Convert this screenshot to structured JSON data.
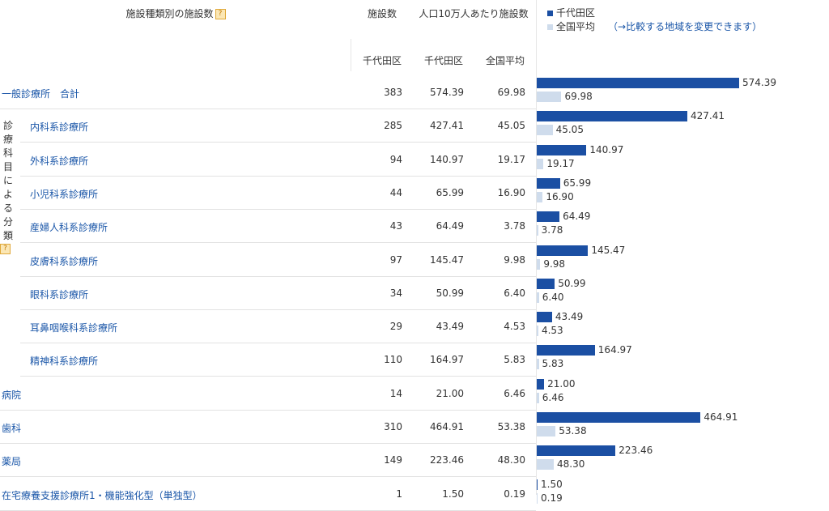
{
  "header": {
    "title": "施設種類別の施設数",
    "help": "?",
    "count": "施設数",
    "per_capita": "人口10万人あたり施設数",
    "sub_count": "千代田区",
    "sub_per": "千代田区",
    "sub_nat": "全国平均"
  },
  "legend": {
    "region": "千代田区",
    "national": "全国平均",
    "change_link": "（→比較する地域を変更できます）"
  },
  "colors": {
    "region": "#1b4fa3",
    "national": "#cfdcec",
    "link": "#1a56a8"
  },
  "group_label": [
    "診",
    "療",
    "科",
    "目",
    "に",
    "よ",
    "る",
    "分",
    "類"
  ],
  "rows": [
    {
      "label": "一般診療所　合計",
      "count": "383",
      "per": "574.39",
      "nat": "69.98",
      "v1": 574.39,
      "v2": 69.98
    },
    {
      "label": "内科系診療所",
      "count": "285",
      "per": "427.41",
      "nat": "45.05",
      "v1": 427.41,
      "v2": 45.05,
      "indent": true
    },
    {
      "label": "外科系診療所",
      "count": "94",
      "per": "140.97",
      "nat": "19.17",
      "v1": 140.97,
      "v2": 19.17,
      "indent": true
    },
    {
      "label": "小児科系診療所",
      "count": "44",
      "per": "65.99",
      "nat": "16.90",
      "v1": 65.99,
      "v2": 16.9,
      "indent": true
    },
    {
      "label": "産婦人科系診療所",
      "count": "43",
      "per": "64.49",
      "nat": "3.78",
      "v1": 64.49,
      "v2": 3.78,
      "indent": true
    },
    {
      "label": "皮膚科系診療所",
      "count": "97",
      "per": "145.47",
      "nat": "9.98",
      "v1": 145.47,
      "v2": 9.98,
      "indent": true
    },
    {
      "label": "眼科系診療所",
      "count": "34",
      "per": "50.99",
      "nat": "6.40",
      "v1": 50.99,
      "v2": 6.4,
      "indent": true
    },
    {
      "label": "耳鼻咽喉科系診療所",
      "count": "29",
      "per": "43.49",
      "nat": "4.53",
      "v1": 43.49,
      "v2": 4.53,
      "indent": true
    },
    {
      "label": "精神科系診療所",
      "count": "110",
      "per": "164.97",
      "nat": "5.83",
      "v1": 164.97,
      "v2": 5.83,
      "indent": true
    },
    {
      "label": "病院",
      "count": "14",
      "per": "21.00",
      "nat": "6.46",
      "v1": 21.0,
      "v2": 6.46
    },
    {
      "label": "歯科",
      "count": "310",
      "per": "464.91",
      "nat": "53.38",
      "v1": 464.91,
      "v2": 53.38
    },
    {
      "label": "薬局",
      "count": "149",
      "per": "223.46",
      "nat": "48.30",
      "v1": 223.46,
      "v2": 48.3
    },
    {
      "label": "在宅療養支援診療所1・機能強化型（単独型）",
      "count": "1",
      "per": "1.50",
      "nat": "0.19",
      "v1": 1.5,
      "v2": 0.19
    }
  ],
  "chart_data": {
    "type": "bar",
    "categories": [
      "一般診療所　合計",
      "内科系診療所",
      "外科系診療所",
      "小児科系診療所",
      "産婦人科系診療所",
      "皮膚科系診療所",
      "眼科系診療所",
      "耳鼻咽喉科系診療所",
      "精神科系診療所",
      "病院",
      "歯科",
      "薬局",
      "在宅療養支援診療所1・機能強化型（単独型）"
    ],
    "series": [
      {
        "name": "千代田区",
        "values": [
          574.39,
          427.41,
          140.97,
          65.99,
          64.49,
          145.47,
          50.99,
          43.49,
          164.97,
          21.0,
          464.91,
          223.46,
          1.5
        ]
      },
      {
        "name": "全国平均",
        "values": [
          69.98,
          45.05,
          19.17,
          16.9,
          3.78,
          9.98,
          6.4,
          4.53,
          5.83,
          6.46,
          53.38,
          48.3,
          0.19
        ]
      }
    ]
  }
}
